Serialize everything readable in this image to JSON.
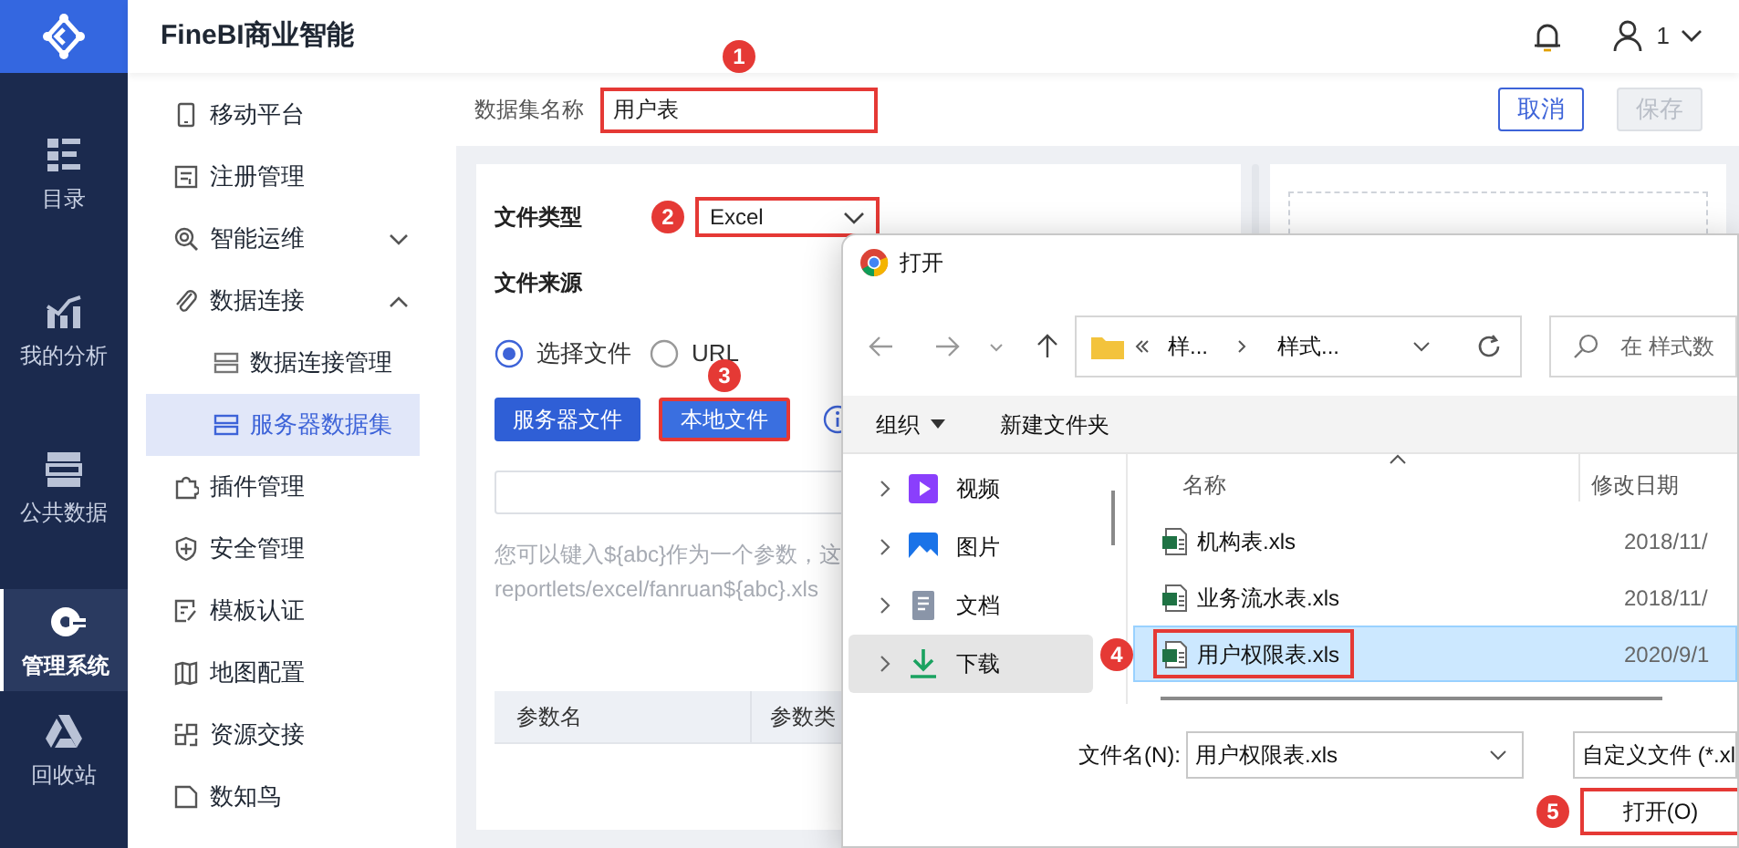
{
  "rail": {
    "items": [
      {
        "label": "目录",
        "selected": false
      },
      {
        "label": "我的分析",
        "selected": false
      },
      {
        "label": "公共数据",
        "selected": false
      },
      {
        "label": "管理系统",
        "selected": true
      },
      {
        "label": "回收站",
        "selected": false
      }
    ]
  },
  "header": {
    "title": "FineBI商业智能",
    "user": "1"
  },
  "sidebar": {
    "items": [
      {
        "label": "移动平台",
        "selected": false
      },
      {
        "label": "注册管理",
        "selected": false
      },
      {
        "label": "智能运维",
        "selected": false,
        "expanded": false
      },
      {
        "label": "数据连接",
        "selected": false,
        "expanded": true,
        "children": [
          {
            "label": "数据连接管理",
            "selected": false
          },
          {
            "label": "服务器数据集",
            "selected": true
          }
        ]
      },
      {
        "label": "插件管理",
        "selected": false
      },
      {
        "label": "安全管理",
        "selected": false
      },
      {
        "label": "模板认证",
        "selected": false
      },
      {
        "label": "地图配置",
        "selected": false
      },
      {
        "label": "资源交接",
        "selected": false
      },
      {
        "label": "数知鸟",
        "selected": false
      }
    ]
  },
  "dataset_name": {
    "label": "数据集名称",
    "value": "用户表",
    "marker": "1"
  },
  "actions": [
    {
      "label": "取消",
      "disabled": false
    },
    {
      "label": "保存",
      "disabled": true
    }
  ],
  "form": {
    "file_type": {
      "label": "文件类型",
      "value": "Excel",
      "marker": "2"
    },
    "file_source": {
      "label": "文件来源",
      "options": [
        {
          "label": "选择文件",
          "selected": true
        },
        {
          "label": "URL",
          "selected": false
        }
      ]
    },
    "buttons": [
      {
        "label": "服务器文件"
      },
      {
        "label": "本地文件",
        "marker": "3"
      }
    ],
    "help_lines": [
      "您可以键入${abc}作为一个参数，这",
      "reportlets/excel/fanruan${abc}.xls"
    ],
    "table": {
      "columns": [
        "参数名",
        "参数类"
      ]
    }
  },
  "dialog": {
    "title": "打开",
    "path": [
      "样...",
      "样式..."
    ],
    "search_placeholder": "在 样式数",
    "toolbar": [
      "组织",
      "新建文件夹"
    ],
    "nav": [
      {
        "label": "视频",
        "selected": false
      },
      {
        "label": "图片",
        "selected": false
      },
      {
        "label": "文档",
        "selected": false
      },
      {
        "label": "下载",
        "selected": true
      }
    ],
    "columns": [
      "名称",
      "修改日期"
    ],
    "files": [
      {
        "name": "机构表.xls",
        "date": "2018/11/",
        "selected": false
      },
      {
        "name": "业务流水表.xls",
        "date": "2018/11/",
        "selected": false
      },
      {
        "name": "用户权限表.xls",
        "date": "2020/9/1",
        "selected": true,
        "marker": "4"
      }
    ],
    "filename_label": "文件名(N):",
    "filename": "用户权限表.xls",
    "filter": "自定义文件 (*.xl",
    "open": {
      "label": "打开(O)",
      "marker": "5"
    }
  }
}
